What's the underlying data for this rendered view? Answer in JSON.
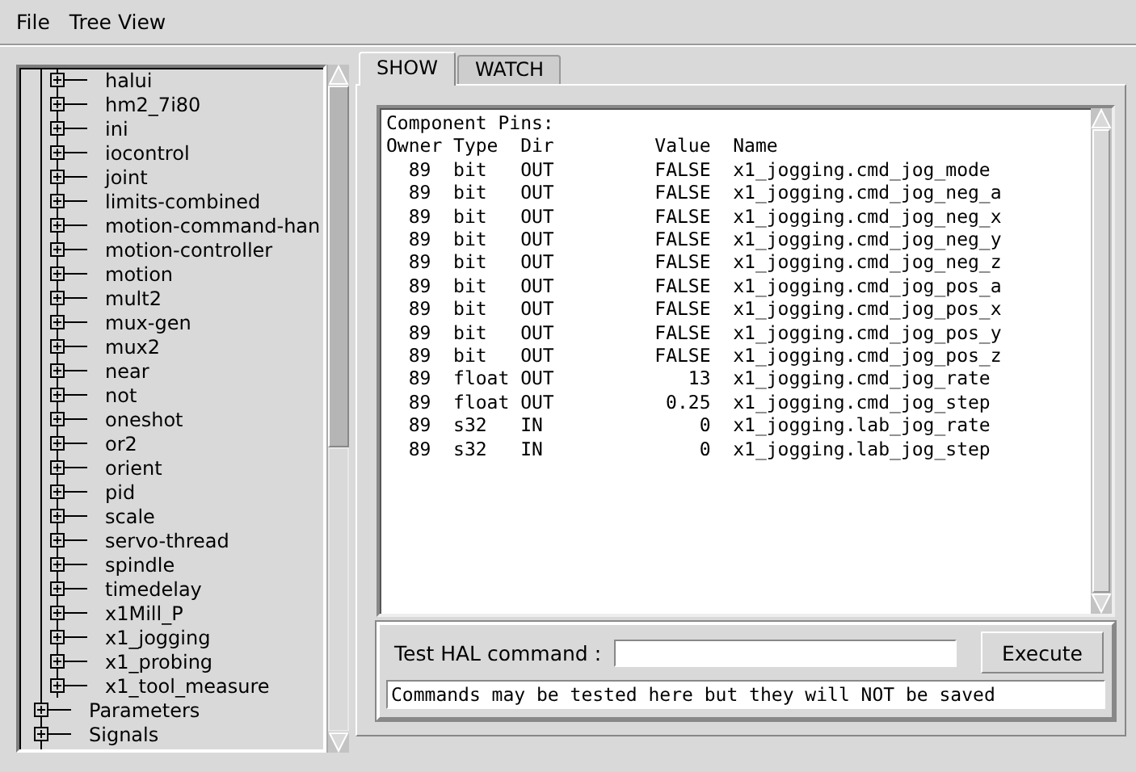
{
  "menu": [
    "File",
    "Tree View"
  ],
  "tree": {
    "items": [
      {
        "children": [
          {
            "label": "halui",
            "expanded": false
          },
          {
            "label": "hm2_7i80",
            "expanded": false
          },
          {
            "label": "ini",
            "expanded": false
          },
          {
            "label": "iocontrol",
            "expanded": false
          },
          {
            "label": "joint",
            "expanded": false
          },
          {
            "label": "limits-combined",
            "expanded": false
          },
          {
            "label": "motion-command-han",
            "expanded": false
          },
          {
            "label": "motion-controller",
            "expanded": false
          },
          {
            "label": "motion",
            "expanded": false
          },
          {
            "label": "mult2",
            "expanded": false
          },
          {
            "label": "mux-gen",
            "expanded": false
          },
          {
            "label": "mux2",
            "expanded": false
          },
          {
            "label": "near",
            "expanded": false
          },
          {
            "label": "not",
            "expanded": false
          },
          {
            "label": "oneshot",
            "expanded": false
          },
          {
            "label": "or2",
            "expanded": false
          },
          {
            "label": "orient",
            "expanded": false
          },
          {
            "label": "pid",
            "expanded": false
          },
          {
            "label": "scale",
            "expanded": false
          },
          {
            "label": "servo-thread",
            "expanded": false
          },
          {
            "label": "spindle",
            "expanded": false
          },
          {
            "label": "timedelay",
            "expanded": false
          },
          {
            "label": "x1Mill_P",
            "expanded": false
          },
          {
            "label": "x1_jogging",
            "expanded": false
          },
          {
            "label": "x1_probing",
            "expanded": false
          },
          {
            "label": "x1_tool_measure",
            "expanded": false
          }
        ]
      },
      {
        "label": "Parameters",
        "expanded": false
      },
      {
        "label": "Signals",
        "expanded": false
      }
    ]
  },
  "tabs": [
    {
      "label": "SHOW",
      "selected": true
    },
    {
      "label": "WATCH",
      "selected": false
    }
  ],
  "pins": {
    "title": "Component Pins:",
    "columns": [
      "Owner",
      "Type",
      "Dir",
      "Value",
      "Name"
    ],
    "rows": [
      [
        "89",
        "bit",
        "OUT",
        "FALSE",
        "x1_jogging.cmd_jog_mode"
      ],
      [
        "89",
        "bit",
        "OUT",
        "FALSE",
        "x1_jogging.cmd_jog_neg_a"
      ],
      [
        "89",
        "bit",
        "OUT",
        "FALSE",
        "x1_jogging.cmd_jog_neg_x"
      ],
      [
        "89",
        "bit",
        "OUT",
        "FALSE",
        "x1_jogging.cmd_jog_neg_y"
      ],
      [
        "89",
        "bit",
        "OUT",
        "FALSE",
        "x1_jogging.cmd_jog_neg_z"
      ],
      [
        "89",
        "bit",
        "OUT",
        "FALSE",
        "x1_jogging.cmd_jog_pos_a"
      ],
      [
        "89",
        "bit",
        "OUT",
        "FALSE",
        "x1_jogging.cmd_jog_pos_x"
      ],
      [
        "89",
        "bit",
        "OUT",
        "FALSE",
        "x1_jogging.cmd_jog_pos_y"
      ],
      [
        "89",
        "bit",
        "OUT",
        "FALSE",
        "x1_jogging.cmd_jog_pos_z"
      ],
      [
        "89",
        "float",
        "OUT",
        "13",
        "x1_jogging.cmd_jog_rate"
      ],
      [
        "89",
        "float",
        "OUT",
        "0.25",
        "x1_jogging.cmd_jog_step"
      ],
      [
        "89",
        "s32",
        "IN",
        "0",
        "x1_jogging.lab_jog_rate"
      ],
      [
        "89",
        "s32",
        "IN",
        "0",
        "x1_jogging.lab_jog_step"
      ]
    ]
  },
  "command": {
    "label": "Test HAL command :",
    "button": "Execute",
    "message": "Commands may be tested here but they will NOT be saved"
  }
}
